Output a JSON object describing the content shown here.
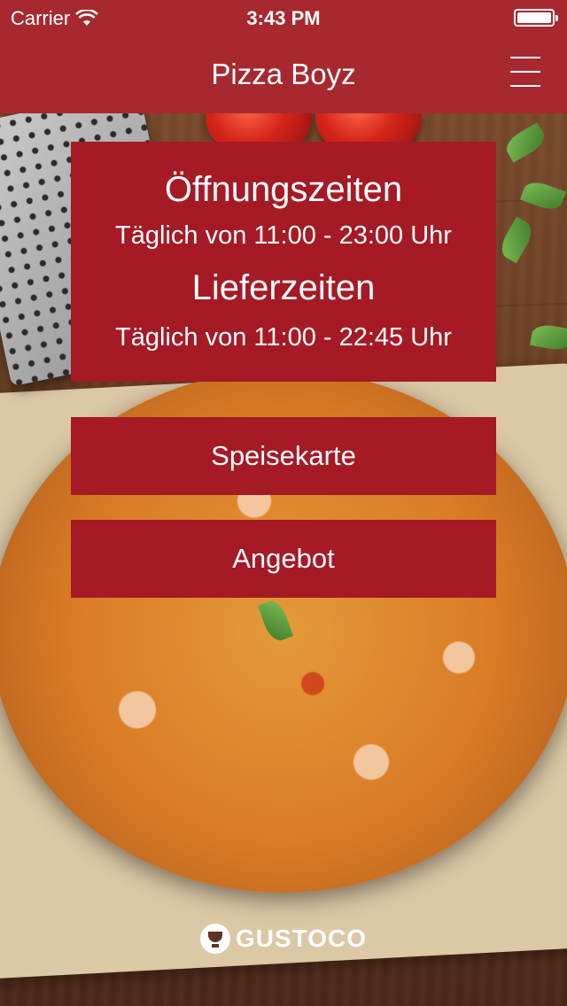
{
  "status_bar": {
    "carrier": "Carrier",
    "time": "3:43 PM",
    "icons": [
      "wifi-icon",
      "battery-icon"
    ]
  },
  "nav": {
    "title": "Pizza Boyz",
    "menu_icon": "hamburger-menu-icon"
  },
  "hours": {
    "opening_heading": "Öffnungszeiten",
    "opening_text": "Täglich von 11:00 - 23:00 Uhr",
    "delivery_heading": "Lieferzeiten",
    "delivery_text": "Täglich von 11:00 - 22:45 Uhr"
  },
  "buttons": {
    "menu_label": "Speisekarte",
    "offer_label": "Angebot"
  },
  "footer": {
    "logo_text": "GUSTOCO",
    "logo_icon": "gustoco-logo-icon"
  },
  "colors": {
    "nav_bar": "#a8282f",
    "button_background": "#a51a25",
    "text": "#ffffff"
  }
}
